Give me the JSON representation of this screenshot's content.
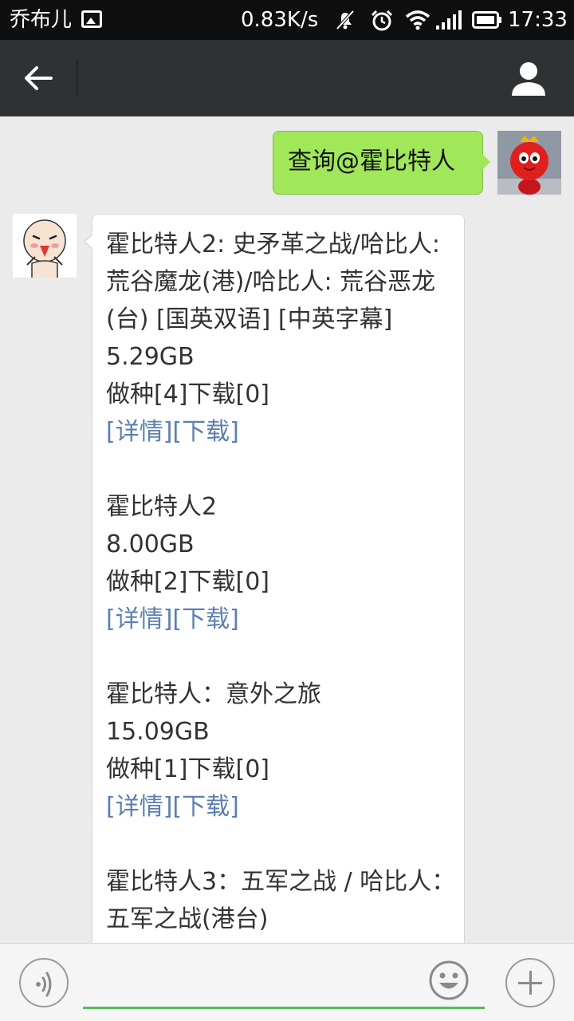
{
  "status_bar": {
    "carrier": "乔布儿",
    "speed": "0.83K/s",
    "time": "17:33",
    "icons": [
      "image-notification-icon",
      "mute-icon",
      "alarm-icon",
      "wifi-icon",
      "signal-icon",
      "battery-icon"
    ]
  },
  "header": {
    "title": "",
    "back_icon": "arrow-left-icon",
    "profile_icon": "person-icon"
  },
  "messages": {
    "outgoing": {
      "text": "查询@霍比特人"
    },
    "results": [
      {
        "title": "霍比特人2: 史矛革之战/哈比人: 荒谷魔龙(港)/哈比人: 荒谷恶龙(台) [国英双语] [中英字幕]",
        "size": "5.29GB",
        "stats": "做种[4]下载[0]",
        "detail_link": "[详情]",
        "download_link": "[下载]"
      },
      {
        "title": "霍比特人2",
        "size": "8.00GB",
        "stats": "做种[2]下载[0]",
        "detail_link": "[详情]",
        "download_link": "[下载]"
      },
      {
        "title": "霍比特人：意外之旅",
        "size": "15.09GB",
        "stats": "做种[1]下载[0]",
        "detail_link": "[详情]",
        "download_link": "[下载]"
      },
      {
        "title": "霍比特人3：五军之战 / 哈比人：五军之战(港台)"
      }
    ]
  },
  "input_bar": {
    "value": "",
    "icons": [
      "voice-icon",
      "emoji-icon",
      "plus-icon"
    ]
  },
  "colors": {
    "outgoing_bubble": "#a0e75a",
    "link": "#5b7fb1",
    "title_bar": "#2f3235",
    "input_underline": "#5cb85c"
  }
}
